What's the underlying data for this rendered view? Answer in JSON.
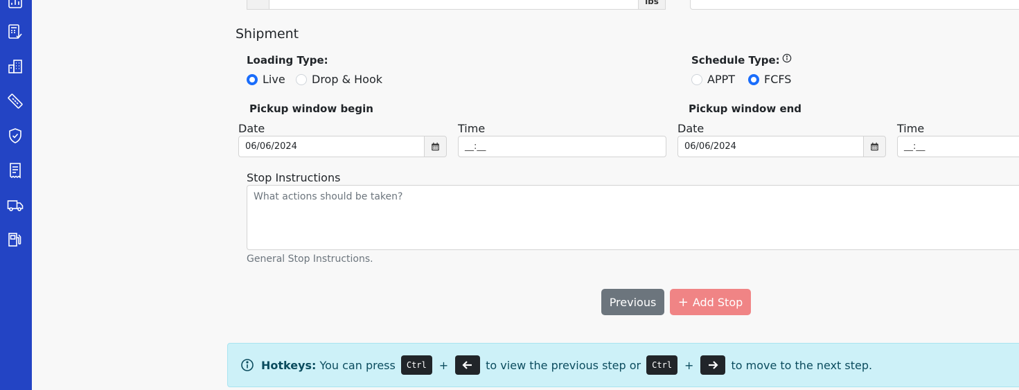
{
  "sidebar": {
    "icons": [
      "chart-icon",
      "invoice-check-icon",
      "buildings-icon",
      "ruler-icon",
      "shield-check-icon",
      "receipt-icon",
      "truck-icon",
      "fuel-icon"
    ],
    "color": "#2344c4"
  },
  "top": {
    "weight_unit": "lbs"
  },
  "shipment": {
    "title": "Shipment",
    "loading_type": {
      "label": "Loading Type:",
      "options": [
        "Live",
        "Drop & Hook"
      ],
      "selected": "Live"
    },
    "schedule_type": {
      "label": "Schedule Type:",
      "options": [
        "APPT",
        "FCFS"
      ],
      "selected": "FCFS"
    },
    "pickup_begin": {
      "label": "Pickup window begin",
      "date_label": "Date",
      "date_value": "06/06/2024",
      "time_label": "Time",
      "time_value": "__:__"
    },
    "pickup_end": {
      "label": "Pickup window end",
      "date_label": "Date",
      "date_value": "06/06/2024",
      "time_label": "Time",
      "time_value": "__:__"
    },
    "stop_instructions": {
      "label": "Stop Instructions",
      "placeholder": "What actions should be taken?",
      "help": "General Stop Instructions."
    }
  },
  "buttons": {
    "previous": "Previous",
    "add_stop": "Add Stop",
    "add_stop_prefix": "+"
  },
  "hotkeys": {
    "title": "Hotkeys:",
    "text1": "You can press",
    "key_ctrl": "Ctrl",
    "plus": "+",
    "text2": "to view the previous step or",
    "text3": "to move to the next step."
  },
  "colors": {
    "accent": "#1a6dfb",
    "add_stop_btn": "#f08485",
    "previous_btn": "#6c757d",
    "hotkeys_bg": "#cdf1f8"
  }
}
